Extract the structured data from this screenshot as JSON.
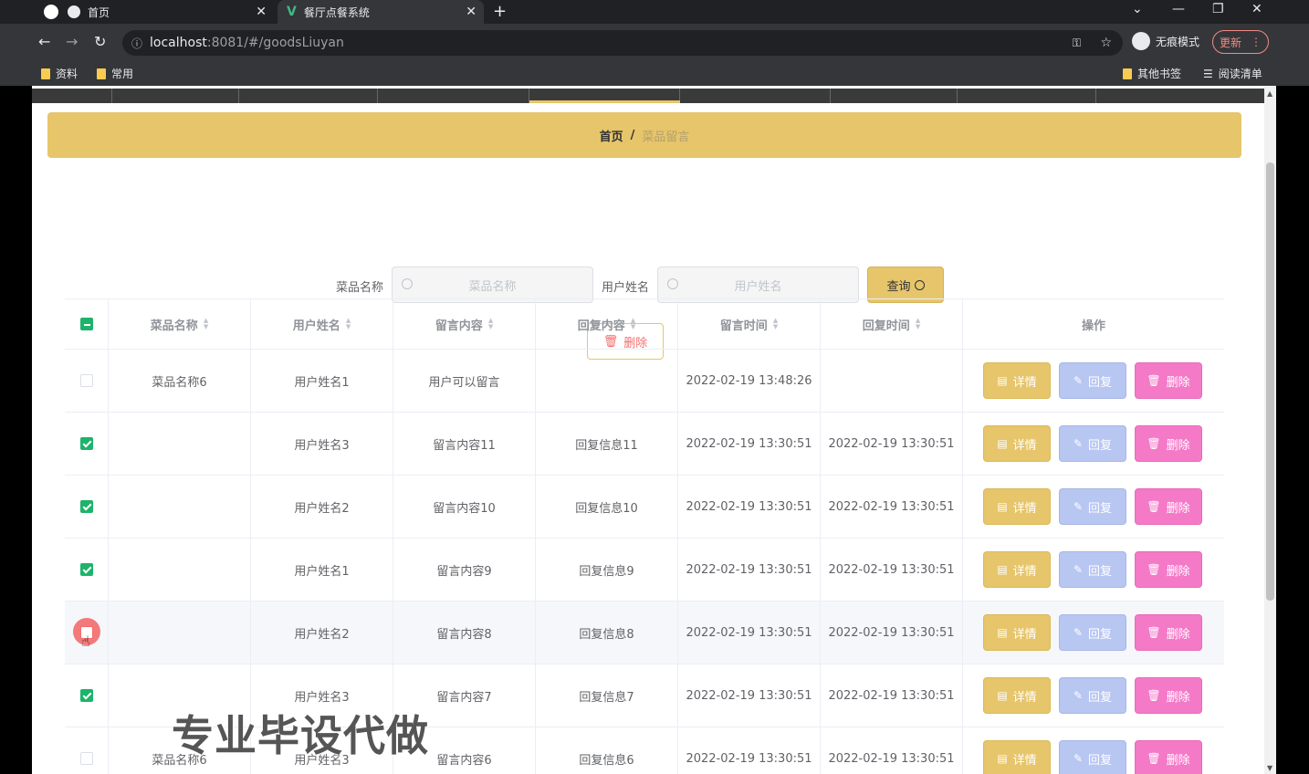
{
  "browser": {
    "tabs": [
      {
        "label": "首页",
        "icon": "globe-icon"
      },
      {
        "label": "餐厅点餐系统",
        "icon": "vue-logo-icon"
      }
    ],
    "url_host": "localhost",
    "url_path": ":8081/#/goodsLiuyan",
    "incognito_label": "无痕模式",
    "update_label": "更新",
    "bookmarks": [
      "资料",
      "常用"
    ],
    "bookmarks_right": [
      "其他书签",
      "阅读清单"
    ]
  },
  "breadcrumb": {
    "home": "首页",
    "separator": "/",
    "current": "菜品留言"
  },
  "search": {
    "dish_label": "菜品名称",
    "dish_placeholder": "菜品名称",
    "user_label": "用户姓名",
    "user_placeholder": "用户姓名",
    "query_label": "查询"
  },
  "bulk_delete_label": "删除",
  "table": {
    "headers": [
      "菜品名称",
      "用户姓名",
      "留言内容",
      "回复内容",
      "留言时间",
      "回复时间",
      "操作"
    ],
    "actions": {
      "detail": "详情",
      "reply": "回复",
      "remove": "删除"
    },
    "rows": [
      {
        "checked": false,
        "dish": "菜品名称6",
        "user": "用户姓名1",
        "message": "用户可以留言",
        "reply": "",
        "msg_time": "2022-02-19 13:48:26",
        "reply_time": ""
      },
      {
        "checked": true,
        "dish": "",
        "user": "用户姓名3",
        "message": "留言内容11",
        "reply": "回复信息11",
        "msg_time": "2022-02-19 13:30:51",
        "reply_time": "2022-02-19 13:30:51"
      },
      {
        "checked": true,
        "dish": "",
        "user": "用户姓名2",
        "message": "留言内容10",
        "reply": "回复信息10",
        "msg_time": "2022-02-19 13:30:51",
        "reply_time": "2022-02-19 13:30:51"
      },
      {
        "checked": true,
        "dish": "",
        "user": "用户姓名1",
        "message": "留言内容9",
        "reply": "回复信息9",
        "msg_time": "2022-02-19 13:30:51",
        "reply_time": "2022-02-19 13:30:51"
      },
      {
        "checked": false,
        "dish": "",
        "user": "用户姓名2",
        "message": "留言内容8",
        "reply": "回复信息8",
        "msg_time": "2022-02-19 13:30:51",
        "reply_time": "2022-02-19 13:30:51"
      },
      {
        "checked": true,
        "dish": "",
        "user": "用户姓名3",
        "message": "留言内容7",
        "reply": "回复信息7",
        "msg_time": "2022-02-19 13:30:51",
        "reply_time": "2022-02-19 13:30:51"
      },
      {
        "checked": false,
        "dish": "菜品名称6",
        "user": "用户姓名3",
        "message": "留言内容6",
        "reply": "回复信息6",
        "msg_time": "2022-02-19 13:30:51",
        "reply_time": "2022-02-19 13:30:51"
      }
    ]
  },
  "watermark": "专业毕设代做",
  "colors": {
    "accent": "#e6c56b",
    "reply": "#b8c6f2",
    "remove": "#f47ac8",
    "check": "#1db36b"
  }
}
